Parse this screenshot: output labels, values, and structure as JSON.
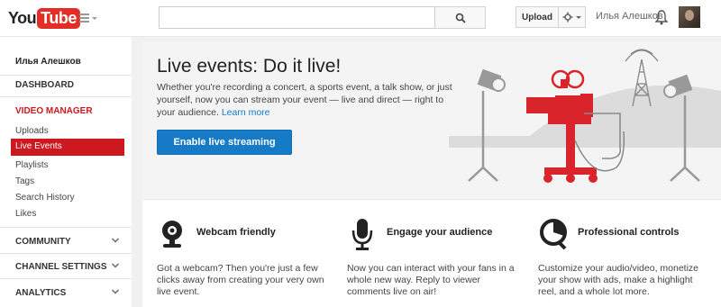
{
  "header": {
    "logo_you": "You",
    "logo_tube": "Tube",
    "search_placeholder": "",
    "upload_label": "Upload",
    "user_name": "Илья Алешков"
  },
  "sidebar": {
    "user_name": "Илья Алешков",
    "dashboard": "DASHBOARD",
    "video_manager": "VIDEO MANAGER",
    "items": [
      "Uploads",
      "Live Events",
      "Playlists",
      "Tags",
      "Search History",
      "Likes"
    ],
    "community": "COMMUNITY",
    "channel_settings": "CHANNEL SETTINGS",
    "analytics": "ANALYTICS"
  },
  "hero": {
    "title": "Live events: Do it live!",
    "text": "Whether you're recording a concert, a sports event, a talk show, or just yourself, now you can stream your event — live and direct — right to your audience.",
    "link": "Learn more",
    "button": "Enable live streaming"
  },
  "features": [
    {
      "icon": "webcam-icon",
      "title": "Webcam friendly",
      "desc": "Got a webcam? Then you're just a few clicks away from creating your very own live event."
    },
    {
      "icon": "microphone-icon",
      "title": "Engage your audience",
      "desc": "Now you can interact with your fans in a whole new way. Reply to viewer comments live on air!"
    },
    {
      "icon": "controls-icon",
      "title": "Professional controls",
      "desc": "Customize your audio/video, monetize your show with ads, make a highlight reel, and a whole lot more."
    }
  ],
  "colors": {
    "brand_red": "#e52d27",
    "nav_active": "#cc181e",
    "button_blue": "#167ac6"
  }
}
